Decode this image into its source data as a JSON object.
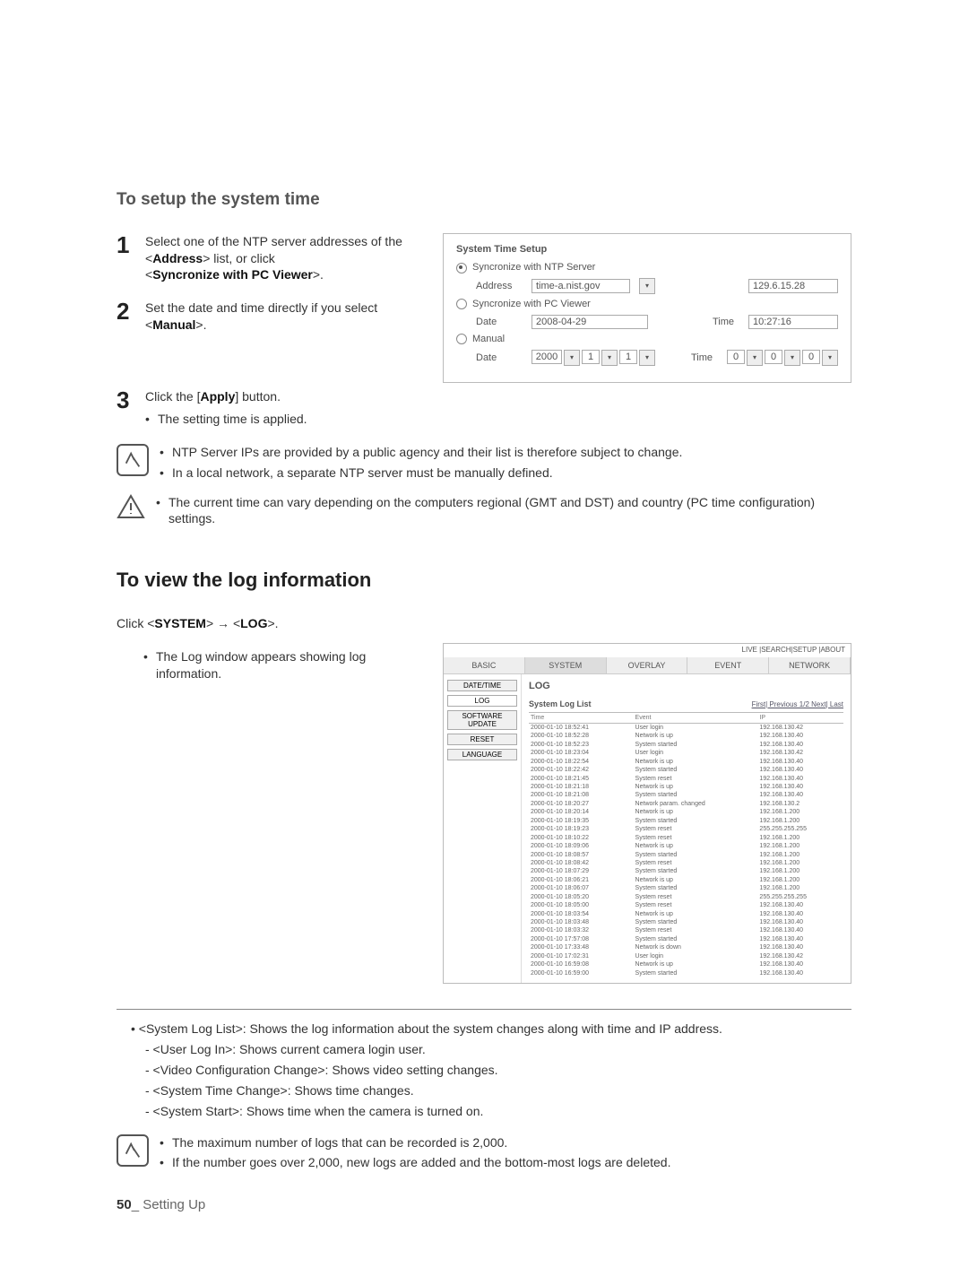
{
  "section1_title": "To setup the system time",
  "steps": [
    {
      "pre": "Select one of the NTP server addresses of the <",
      "b": "Address",
      "post": "> list, or click",
      "line2_pre": "<",
      "line2_b": "Syncronize with PC Viewer",
      "line2_post": ">."
    },
    {
      "pre": "Set the date and time directly if you select <",
      "b": "Manual",
      "post": ">."
    },
    {
      "pre": "Click the [",
      "b": "Apply",
      "post": "] button."
    }
  ],
  "applied_bullet": "The setting time is applied.",
  "note1": [
    "NTP Server IPs are provided by a public agency and their list is therefore subject to change.",
    "In a local network, a separate NTP server must be manually defined."
  ],
  "warn": [
    "The current time can vary depending on the computers regional (GMT and DST) and country (PC time configuration) settings."
  ],
  "section2_title": "To view the log information",
  "click_line": {
    "pre": "Click <",
    "b1": "SYSTEM",
    "mid": "> → <",
    "b2": "LOG",
    "post": ">."
  },
  "log_bullet": "The Log window appears showing log information.",
  "panel": {
    "title": "System Time Setup",
    "opt_ntp": "Syncronize with NTP Server",
    "address_label": "Address",
    "address_value": "time-a.nist.gov",
    "ntp_ip": "129.6.15.28",
    "opt_pc": "Syncronize with PC Viewer",
    "date_label": "Date",
    "date_value": "2008-04-29",
    "time_label": "Time",
    "time_value": "10:27:16",
    "opt_manual": "Manual",
    "manual_year": "2000",
    "manual_mon": "1",
    "manual_day": "1",
    "manual_h": "0",
    "manual_m": "0",
    "manual_s": "0"
  },
  "logshot": {
    "breadcrumb": "LIVE |SEARCH|SETUP |ABOUT",
    "tabs": [
      "BASIC",
      "SYSTEM",
      "OVERLAY",
      "EVENT",
      "NETWORK"
    ],
    "side": [
      "DATE/TIME",
      "LOG",
      "SOFTWARE UPDATE",
      "RESET",
      "LANGUAGE"
    ],
    "title": "LOG",
    "list_title": "System Log List",
    "nav": "First| Previous   1/2   Next| Last",
    "cols": [
      "Time",
      "Event",
      "IP"
    ],
    "rows": [
      [
        "2000-01-10 18:52:41",
        "User login",
        "192.168.130.42"
      ],
      [
        "2000-01-10 18:52:28",
        "Network is up",
        "192.168.130.40"
      ],
      [
        "2000-01-10 18:52:23",
        "System started",
        "192.168.130.40"
      ],
      [
        "2000-01-10 18:23:04",
        "User login",
        "192.168.130.42"
      ],
      [
        "2000-01-10 18:22:54",
        "Network is up",
        "192.168.130.40"
      ],
      [
        "2000-01-10 18:22:42",
        "System started",
        "192.168.130.40"
      ],
      [
        "2000-01-10 18:21:45",
        "System reset",
        "192.168.130.40"
      ],
      [
        "2000-01-10 18:21:18",
        "Network is up",
        "192.168.130.40"
      ],
      [
        "2000-01-10 18:21:08",
        "System started",
        "192.168.130.40"
      ],
      [
        "2000-01-10 18:20:27",
        "Network param. changed",
        "192.168.130.2"
      ],
      [
        "2000-01-10 18:20:14",
        "Network is up",
        "192.168.1.200"
      ],
      [
        "2000-01-10 18:19:35",
        "System started",
        "192.168.1.200"
      ],
      [
        "2000-01-10 18:19:23",
        "System reset",
        "255.255.255.255"
      ],
      [
        "2000-01-10 18:10:22",
        "System reset",
        "192.168.1.200"
      ],
      [
        "2000-01-10 18:09:06",
        "Network is up",
        "192.168.1.200"
      ],
      [
        "2000-01-10 18:08:57",
        "System started",
        "192.168.1.200"
      ],
      [
        "2000-01-10 18:08:42",
        "System reset",
        "192.168.1.200"
      ],
      [
        "2000-01-10 18:07:29",
        "System started",
        "192.168.1.200"
      ],
      [
        "2000-01-10 18:06:21",
        "Network is up",
        "192.168.1.200"
      ],
      [
        "2000-01-10 18:06:07",
        "System started",
        "192.168.1.200"
      ],
      [
        "2000-01-10 18:05:20",
        "System reset",
        "255.255.255.255"
      ],
      [
        "2000-01-10 18:05:00",
        "System reset",
        "192.168.130.40"
      ],
      [
        "2000-01-10 18:03:54",
        "Network is up",
        "192.168.130.40"
      ],
      [
        "2000-01-10 18:03:48",
        "System started",
        "192.168.130.40"
      ],
      [
        "2000-01-10 18:03:32",
        "System reset",
        "192.168.130.40"
      ],
      [
        "2000-01-10 17:57:08",
        "System started",
        "192.168.130.40"
      ],
      [
        "2000-01-10 17:33:48",
        "Network is down",
        "192.168.130.40"
      ],
      [
        "2000-01-10 17:02:31",
        "User login",
        "192.168.130.42"
      ],
      [
        "2000-01-10 16:59:08",
        "Network is up",
        "192.168.130.40"
      ],
      [
        "2000-01-10 16:59:00",
        "System started",
        "192.168.130.40"
      ]
    ]
  },
  "desc": {
    "sysloglist": "<System Log List>: Shows the log information about the system changes along with time and IP address.",
    "items": [
      "- <User Log In>: Shows current camera login user.",
      "- <Video Configuration Change>: Shows video setting changes.",
      "- <System Time Change>: Shows time changes.",
      "- <System Start>: Shows time when the camera is turned on."
    ]
  },
  "note2": [
    "The maximum number of logs that can be recorded is 2,000.",
    "If the number goes over 2,000, new logs are added and the bottom-most logs are deleted."
  ],
  "footer": {
    "page": "50",
    "sep": "_ ",
    "section": "Setting Up"
  }
}
